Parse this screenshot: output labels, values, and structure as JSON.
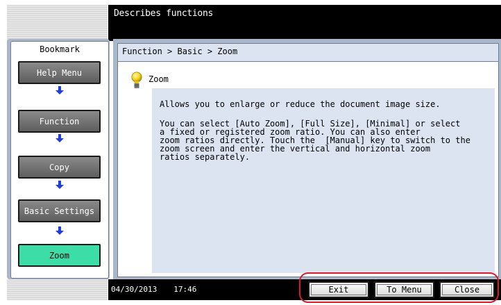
{
  "header": {
    "title": "Describes functions"
  },
  "sidebar": {
    "title": "Bookmark",
    "items": [
      {
        "label": "Help Menu"
      },
      {
        "label": "Function"
      },
      {
        "label": "Copy"
      },
      {
        "label": "Basic Settings"
      },
      {
        "label": "Zoom"
      }
    ]
  },
  "main": {
    "breadcrumb": "Function > Basic > Zoom",
    "help_title": "Zoom",
    "paragraph1": "Allows you to enlarge or reduce the document image size.",
    "paragraph2": "You can select [Auto Zoom], [Full Size], [Minimal] or select\na fixed or registered zoom ratio. You can also enter\nzoom ratios directly. Touch the  [Manual] key to switch to the\nzoom screen and enter the vertical and horizontal zoom\nratios separately."
  },
  "status": {
    "date": "04/30/2013",
    "time": "17:46"
  },
  "buttons": {
    "exit": "Exit",
    "to_menu": "To Menu",
    "close": "Close"
  },
  "colors": {
    "accent_green": "#3ddda8",
    "panel": "#aab7c8",
    "content_bg": "#dce3f1",
    "highlight_ring": "#d81a2a",
    "arrow": "#1f3fd6"
  },
  "icons": {
    "bulb": "lightbulb-icon",
    "arrow": "arrow-down-icon"
  }
}
